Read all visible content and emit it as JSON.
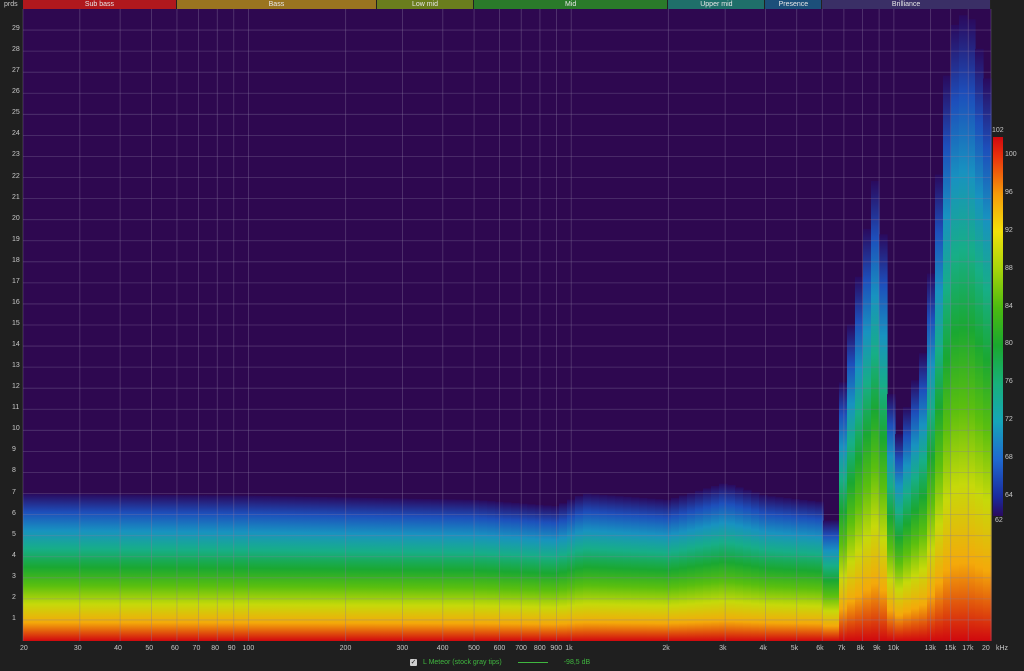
{
  "bands": [
    {
      "label": "Sub bass",
      "from": 20,
      "to": 60,
      "color": "#b0181d"
    },
    {
      "label": "Bass",
      "from": 60,
      "to": 250,
      "color": "#9a7420"
    },
    {
      "label": "Low mid",
      "from": 250,
      "to": 500,
      "color": "#6a7d1d"
    },
    {
      "label": "Mid",
      "from": 500,
      "to": 2000,
      "color": "#2a7a2a"
    },
    {
      "label": "Upper mid",
      "from": 2000,
      "to": 4000,
      "color": "#1f6f6a"
    },
    {
      "label": "Presence",
      "from": 4000,
      "to": 6000,
      "color": "#1c4f7a"
    },
    {
      "label": "Brilliance",
      "from": 6000,
      "to": 20000,
      "color": "#3a2f66"
    }
  ],
  "y_unit": "prds",
  "x_unit": "kHz",
  "chart_data": {
    "type": "heatmap",
    "title": "",
    "x_scale": "log",
    "xlim": [
      20,
      20000
    ],
    "ylim": [
      0,
      30
    ],
    "x_ticks": [
      {
        "value": 20,
        "label": "20"
      },
      {
        "value": 30,
        "label": "30"
      },
      {
        "value": 40,
        "label": "40"
      },
      {
        "value": 50,
        "label": "50"
      },
      {
        "value": 60,
        "label": "60"
      },
      {
        "value": 70,
        "label": "70"
      },
      {
        "value": 80,
        "label": "80"
      },
      {
        "value": 90,
        "label": "90"
      },
      {
        "value": 100,
        "label": "100"
      },
      {
        "value": 200,
        "label": "200"
      },
      {
        "value": 300,
        "label": "300"
      },
      {
        "value": 400,
        "label": "400"
      },
      {
        "value": 500,
        "label": "500"
      },
      {
        "value": 600,
        "label": "600"
      },
      {
        "value": 700,
        "label": "700"
      },
      {
        "value": 800,
        "label": "800"
      },
      {
        "value": 900,
        "label": "900"
      },
      {
        "value": 1000,
        "label": "1k"
      },
      {
        "value": 2000,
        "label": "2k"
      },
      {
        "value": 3000,
        "label": "3k"
      },
      {
        "value": 4000,
        "label": "4k"
      },
      {
        "value": 5000,
        "label": "5k"
      },
      {
        "value": 6000,
        "label": "6k"
      },
      {
        "value": 7000,
        "label": "7k"
      },
      {
        "value": 8000,
        "label": "8k"
      },
      {
        "value": 9000,
        "label": "9k"
      },
      {
        "value": 10000,
        "label": "10k"
      },
      {
        "value": 13000,
        "label": "13k"
      },
      {
        "value": 15000,
        "label": "15k"
      },
      {
        "value": 17000,
        "label": "17k"
      },
      {
        "value": 20000,
        "label": "20"
      }
    ],
    "y_ticks": [
      1,
      2,
      3,
      4,
      5,
      6,
      7,
      8,
      9,
      10,
      11,
      12,
      13,
      14,
      15,
      16,
      17,
      18,
      19,
      20,
      21,
      22,
      23,
      24,
      25,
      26,
      27,
      28,
      29
    ],
    "color_scale": {
      "min": 62,
      "max": 102,
      "labels": [
        102,
        100,
        96,
        92,
        88,
        84,
        80,
        76,
        72,
        68,
        64,
        62
      ],
      "stops": [
        {
          "value": 62,
          "color": "#2a0a5e"
        },
        {
          "value": 64,
          "color": "#1a2a9e"
        },
        {
          "value": 68,
          "color": "#1f6ad0"
        },
        {
          "value": 72,
          "color": "#15a6b8"
        },
        {
          "value": 76,
          "color": "#18b07a"
        },
        {
          "value": 80,
          "color": "#1aa82e"
        },
        {
          "value": 84,
          "color": "#4cbb10"
        },
        {
          "value": 88,
          "color": "#a6d40a"
        },
        {
          "value": 92,
          "color": "#f2e10a"
        },
        {
          "value": 96,
          "color": "#f49a0a"
        },
        {
          "value": 100,
          "color": "#e8300c"
        },
        {
          "value": 102,
          "color": "#d0080e"
        }
      ]
    },
    "background_color": "#2e0850",
    "series": [
      {
        "name": "L Meteor (stock gray tips)",
        "decay_extent": [
          {
            "freq": 20,
            "y": 7.0
          },
          {
            "freq": 100,
            "y": 6.9
          },
          {
            "freq": 500,
            "y": 6.7
          },
          {
            "freq": 900,
            "y": 6.4
          },
          {
            "freq": 1100,
            "y": 7.0
          },
          {
            "freq": 2000,
            "y": 6.7
          },
          {
            "freq": 3000,
            "y": 7.5
          },
          {
            "freq": 4000,
            "y": 6.9
          },
          {
            "freq": 6000,
            "y": 6.6
          },
          {
            "freq": 6500,
            "y": 4.5
          },
          {
            "freq": 7000,
            "y": 13.0
          },
          {
            "freq": 9000,
            "y": 23.0
          },
          {
            "freq": 10000,
            "y": 9.0
          },
          {
            "freq": 12500,
            "y": 14.0
          },
          {
            "freq": 15000,
            "y": 29.0
          },
          {
            "freq": 17000,
            "y": 30.0
          },
          {
            "freq": 20000,
            "y": 26.0
          }
        ]
      }
    ]
  },
  "legend": {
    "checkbox_mark": "✓",
    "series_label": "L Meteor (stock gray tips)",
    "value": "-98,5 dB"
  }
}
